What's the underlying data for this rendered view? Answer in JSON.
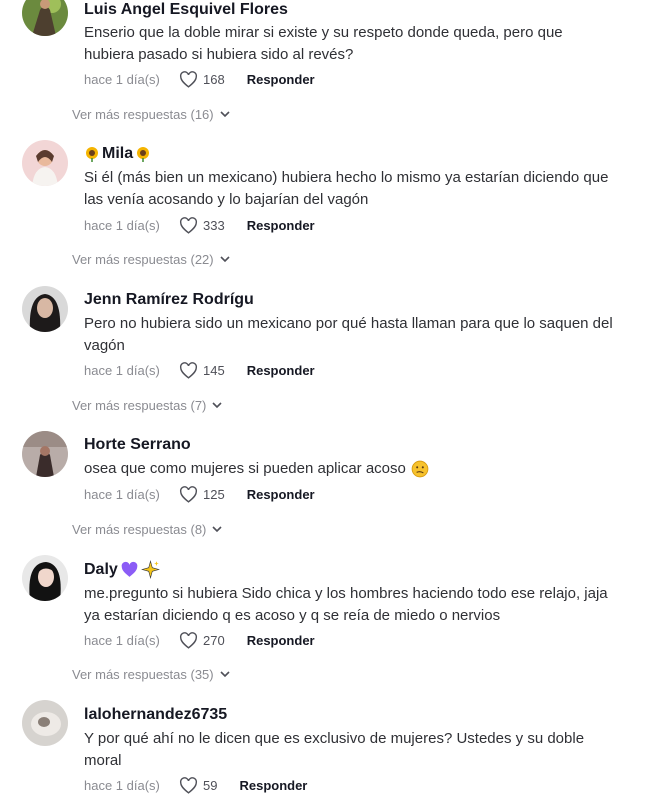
{
  "comments": [
    {
      "username": "Luis Angel Esquivel Flores",
      "text": "Enserio que la doble mirar si existe y su respeto donde queda, pero que hubiera pasado si hubiera sido al revés?",
      "time": "hace 1 día(s)",
      "likes": "168",
      "reply_label": "Responder",
      "more_replies": "Ver más respuestas (16)"
    },
    {
      "username": "Mila",
      "username_emoji": "sunflower-icon",
      "text": "Si él (más bien un mexicano) hubiera hecho lo mismo ya estarían diciendo que las venía acosando y lo bajarían del vagón",
      "time": "hace 1 día(s)",
      "likes": "333",
      "reply_label": "Responder",
      "more_replies": "Ver más respuestas (22)"
    },
    {
      "username": "Jenn Ramírez Rodrígu",
      "text": "Pero no hubiera sido un mexicano por qué hasta llaman para que lo saquen del vagón",
      "time": "hace 1 día(s)",
      "likes": "145",
      "reply_label": "Responder",
      "more_replies": "Ver más respuestas (7)"
    },
    {
      "username": "Horte Serrano",
      "text": "osea que como mujeres si pueden aplicar acoso",
      "text_emoji": "confused-face-icon",
      "time": "hace 1 día(s)",
      "likes": "125",
      "reply_label": "Responder",
      "more_replies": "Ver más respuestas (8)"
    },
    {
      "username": "Daly",
      "username_emoji": "purple-heart-icon, sparkles-icon",
      "text": "me.pregunto si hubiera Sido chica y los hombres haciendo todo ese relajo, jaja ya estarían diciendo q es acoso y q se reía de miedo o nervios",
      "time": "hace 1 día(s)",
      "likes": "270",
      "reply_label": "Responder",
      "more_replies": "Ver más respuestas (35)"
    },
    {
      "username": "lalohernandez6735",
      "text": "Y por qué ahí no le dicen que es exclusivo de mujeres? Ustedes y su doble moral",
      "time": "hace 1 día(s)",
      "likes": "59",
      "reply_label": "Responder"
    }
  ]
}
